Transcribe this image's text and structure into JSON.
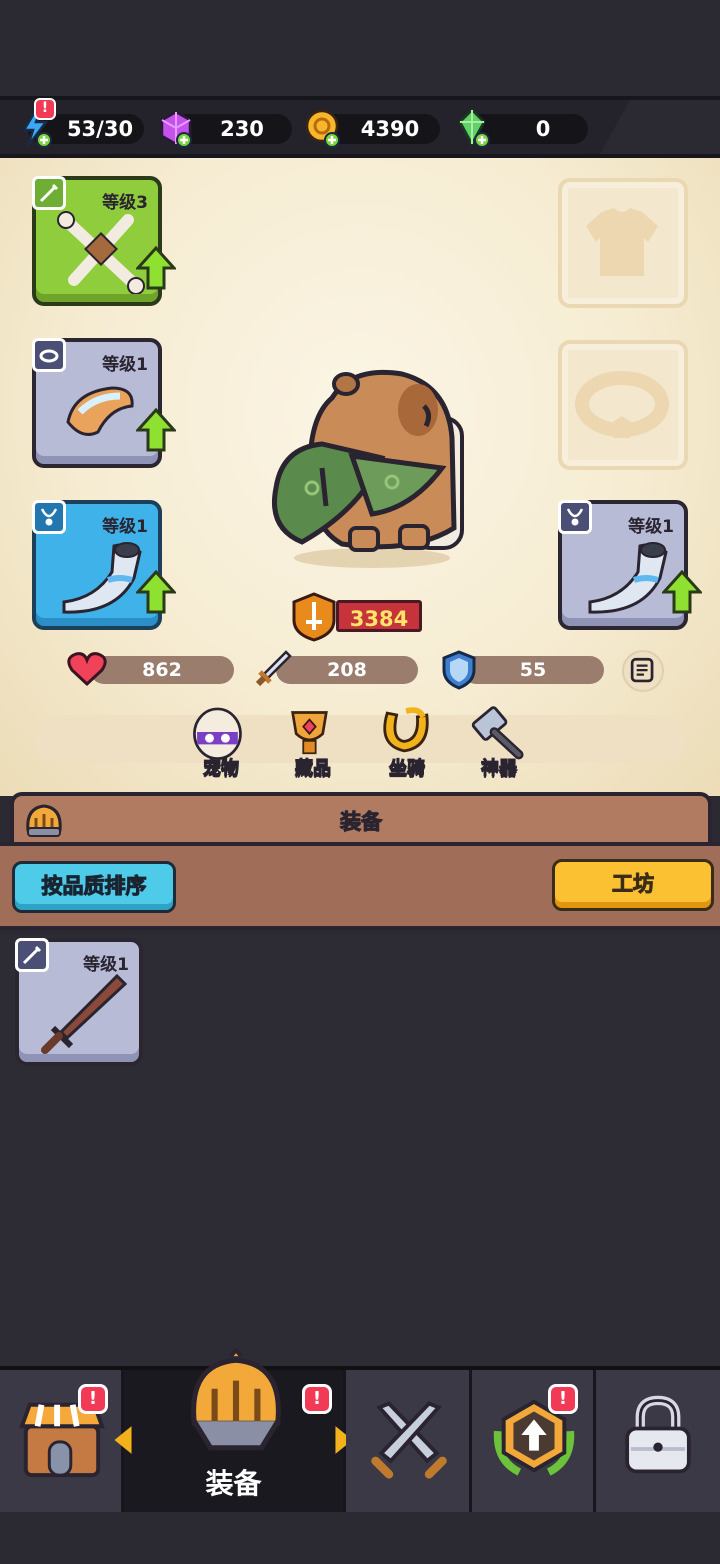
{
  "resources": {
    "energy": "53/30",
    "gems": "230",
    "coins": "4390",
    "crystals": "0",
    "energy_badge": "!"
  },
  "equipment_slots": {
    "weapon_level": "等级3",
    "ring_level": "等级1",
    "necklace_level": "等级1",
    "necklace2_level": "等级1"
  },
  "power": "3384",
  "stats": {
    "hp": "862",
    "attack": "208",
    "defense": "55"
  },
  "sub_tabs": {
    "pet": "宠物",
    "collection": "藏品",
    "mount": "坐骑",
    "artifact": "神器"
  },
  "equip_section": {
    "title": "装备",
    "sort_button": "按品质排序",
    "workshop_button": "工坊"
  },
  "inventory": [
    {
      "level": "等级1"
    }
  ],
  "bottom_nav": {
    "active_label": "装备",
    "badge": "!"
  },
  "colors": {
    "green_rarity": "#8fcd3c",
    "gray_rarity": "#b7bbd6",
    "blue_rarity": "#3fb2ea",
    "power_bg": "#c6333b",
    "sort_button": "#4dcbe9",
    "workshop_button": "#fcc033"
  }
}
